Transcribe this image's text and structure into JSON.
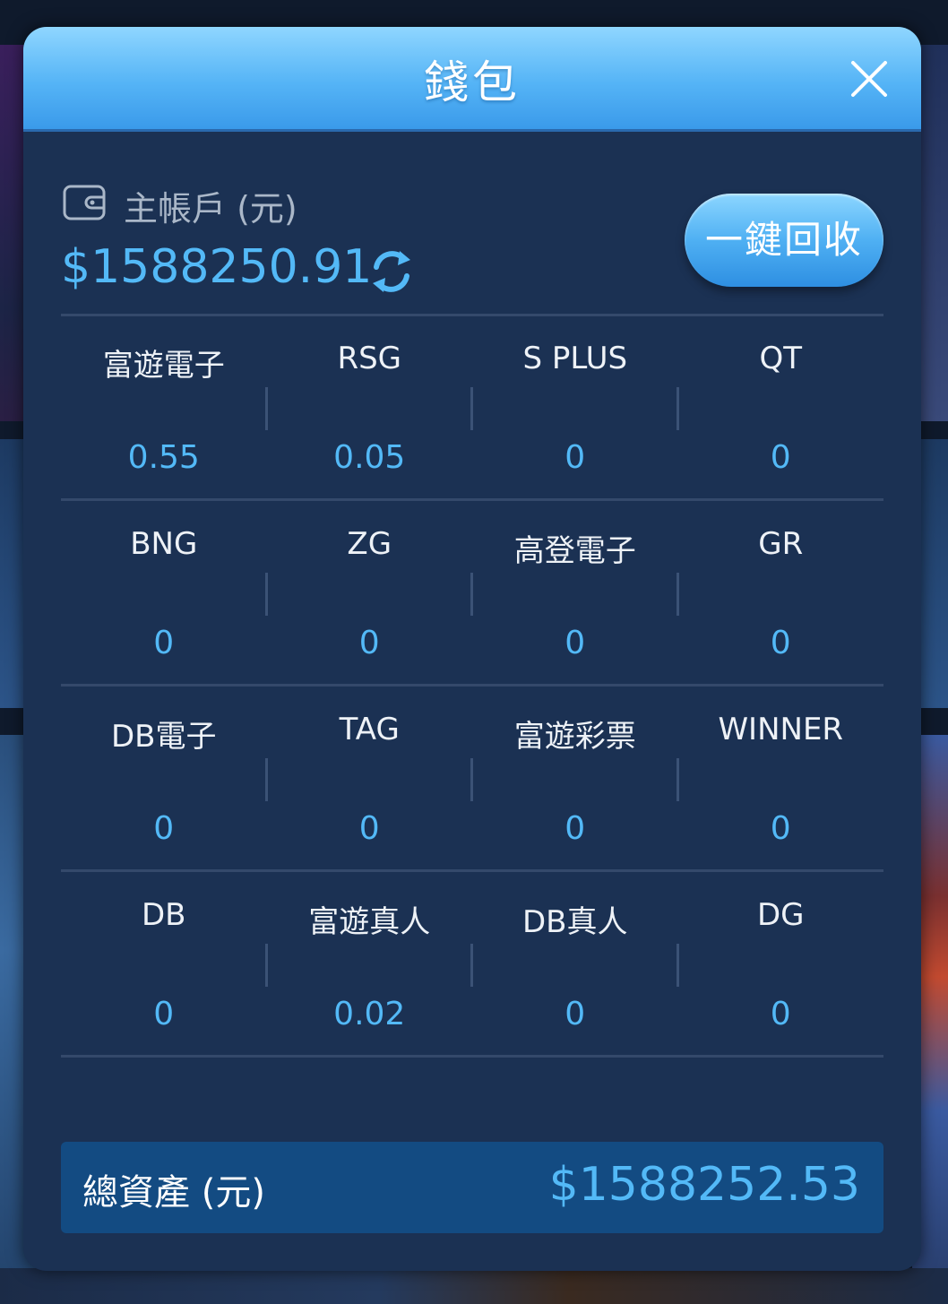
{
  "modal": {
    "title": "錢包"
  },
  "main_account": {
    "label": "主帳戶 (元)",
    "amount": "$1588250.91",
    "recall_button": "一鍵回收"
  },
  "providers": [
    {
      "name": "富遊電子",
      "value": "0.55"
    },
    {
      "name": "RSG",
      "value": "0.05"
    },
    {
      "name": "S PLUS",
      "value": "0"
    },
    {
      "name": "QT",
      "value": "0"
    },
    {
      "name": "BNG",
      "value": "0"
    },
    {
      "name": "ZG",
      "value": "0"
    },
    {
      "name": "高登電子",
      "value": "0"
    },
    {
      "name": "GR",
      "value": "0"
    },
    {
      "name": "DB電子",
      "value": "0"
    },
    {
      "name": "TAG",
      "value": "0"
    },
    {
      "name": "富遊彩票",
      "value": "0"
    },
    {
      "name": "WINNER",
      "value": "0"
    },
    {
      "name": "DB",
      "value": "0"
    },
    {
      "name": "富遊真人",
      "value": "0.02"
    },
    {
      "name": "DB真人",
      "value": "0"
    },
    {
      "name": "DG",
      "value": "0"
    }
  ],
  "total": {
    "label": "總資產 (元)",
    "amount": "$1588252.53"
  },
  "colors": {
    "accent": "#53b9f7",
    "panel": "#1b3153",
    "header": "#55b4f6",
    "total_bar": "#134b82"
  },
  "icons": [
    "wallet-icon",
    "refresh-icon",
    "close-icon"
  ]
}
